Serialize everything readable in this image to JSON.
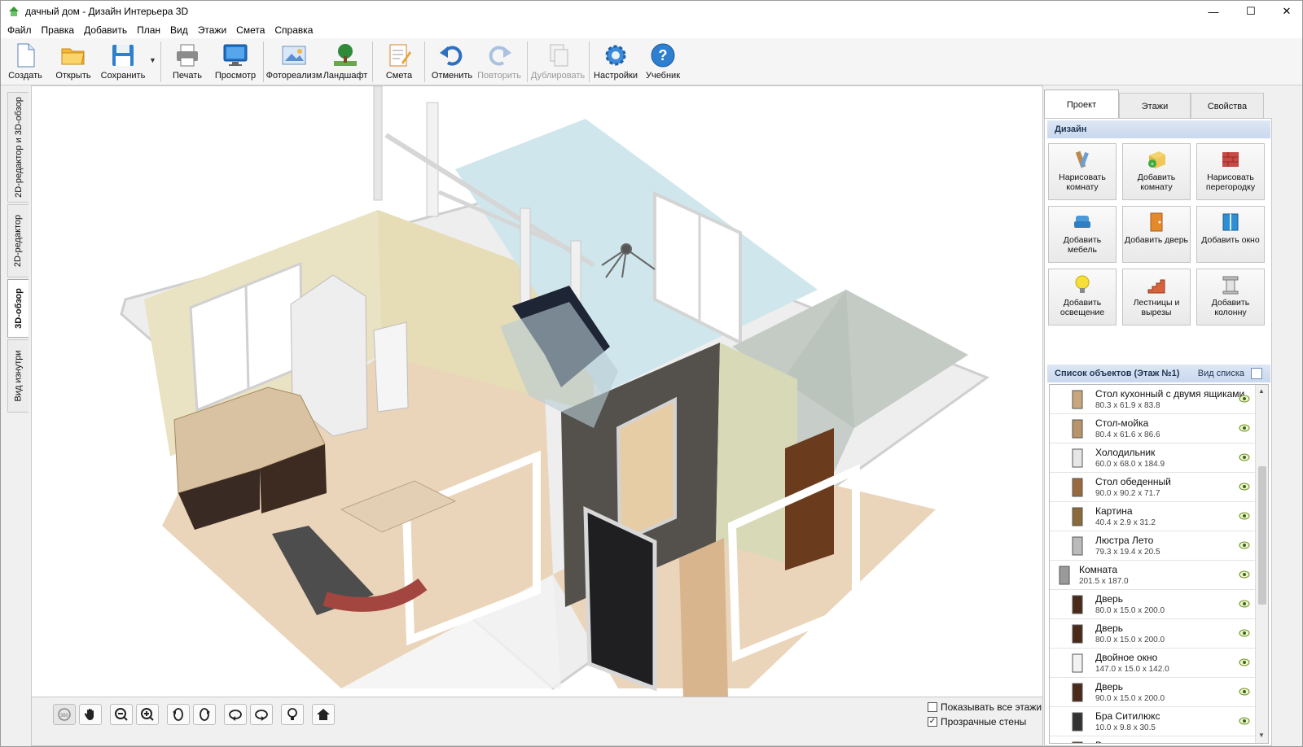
{
  "window": {
    "title": "дачный дом - Дизайн Интерьера 3D",
    "minimize": "—",
    "maximize": "☐",
    "close": "✕"
  },
  "menu": [
    "Файл",
    "Правка",
    "Добавить",
    "План",
    "Вид",
    "Этажи",
    "Смета",
    "Справка"
  ],
  "toolbar": {
    "create": "Создать",
    "open": "Открыть",
    "save": "Сохранить",
    "print": "Печать",
    "preview": "Просмотр",
    "photorealism": "Фотореализм",
    "landscape": "Ландшафт",
    "estimate": "Смета",
    "undo": "Отменить",
    "redo": "Повторить",
    "duplicate": "Дублировать",
    "settings": "Настройки",
    "tutorial": "Учебник"
  },
  "left_tabs": [
    "2D-редактор и 3D-обзор",
    "2D-редактор",
    "3D-обзор",
    "Вид изнутри"
  ],
  "active_left_tab": "3D-обзор",
  "view_options": {
    "show_all_floors": "Показывать все этажи",
    "show_all_floors_checked": false,
    "transparent_walls": "Прозрачные стены",
    "transparent_walls_checked": true
  },
  "right_tabs": [
    "Проект",
    "Этажи",
    "Свойства"
  ],
  "active_right_tab": "Проект",
  "design": {
    "header": "Дизайн",
    "buttons": [
      {
        "label": "Нарисовать комнату",
        "icon": "draw-room-icon"
      },
      {
        "label": "Добавить комнату",
        "icon": "add-room-icon"
      },
      {
        "label": "Нарисовать перегородку",
        "icon": "draw-partition-icon"
      },
      {
        "label": "Добавить мебель",
        "icon": "add-furniture-icon"
      },
      {
        "label": "Добавить дверь",
        "icon": "add-door-icon"
      },
      {
        "label": "Добавить окно",
        "icon": "add-window-icon"
      },
      {
        "label": "Добавить освещение",
        "icon": "add-lighting-icon"
      },
      {
        "label": "Лестницы и вырезы",
        "icon": "stairs-icon"
      },
      {
        "label": "Добавить колонну",
        "icon": "add-column-icon"
      }
    ]
  },
  "objects": {
    "header": "Список объектов (Этаж №1)",
    "view_label": "Вид списка",
    "items": [
      {
        "name": "Стол кухонный с двумя ящиками",
        "dims": "80.3 x 61.9 x 83.8",
        "icon": "kitchen-table-icon"
      },
      {
        "name": "Стол-мойка",
        "dims": "80.4 x 61.6 x 86.6",
        "icon": "sink-table-icon"
      },
      {
        "name": "Холодильник",
        "dims": "60.0 x 68.0 x 184.9",
        "icon": "fridge-icon"
      },
      {
        "name": "Стол обеденный",
        "dims": "90.0 x 90.2 x 71.7",
        "icon": "dining-table-icon"
      },
      {
        "name": "Картина",
        "dims": "40.4 x 2.9 x 31.2",
        "icon": "picture-icon"
      },
      {
        "name": "Люстра Лето",
        "dims": "79.3 x 19.4 x 20.5",
        "icon": "chandelier-icon"
      },
      {
        "name": "Комната",
        "dims": "201.5 x 187.0",
        "icon": "room-icon",
        "room": true
      },
      {
        "name": "Дверь",
        "dims": "80.0 x 15.0 x 200.0",
        "icon": "door-icon"
      },
      {
        "name": "Дверь",
        "dims": "80.0 x 15.0 x 200.0",
        "icon": "door-icon"
      },
      {
        "name": "Двойное окно",
        "dims": "147.0 x 15.0 x 142.0",
        "icon": "double-window-icon"
      },
      {
        "name": "Дверь",
        "dims": "90.0 x 15.0 x 200.0",
        "icon": "door-icon"
      },
      {
        "name": "Бра Ситилюкс",
        "dims": "10.0 x 9.8 x 30.5",
        "icon": "sconce-icon"
      },
      {
        "name": "Вешалка",
        "dims": "",
        "icon": "hanger-icon"
      }
    ]
  },
  "view_controls": [
    "rotate-360-icon",
    "pan-hand-icon",
    "zoom-out-icon",
    "zoom-in-icon",
    "rotate-left-icon",
    "rotate-right-icon",
    "tilt-up-icon",
    "tilt-down-icon",
    "light-bulb-icon",
    "home-icon"
  ],
  "colors": {
    "accent_blue": "#2f7fd1",
    "section_header": "#c9d8ee"
  }
}
